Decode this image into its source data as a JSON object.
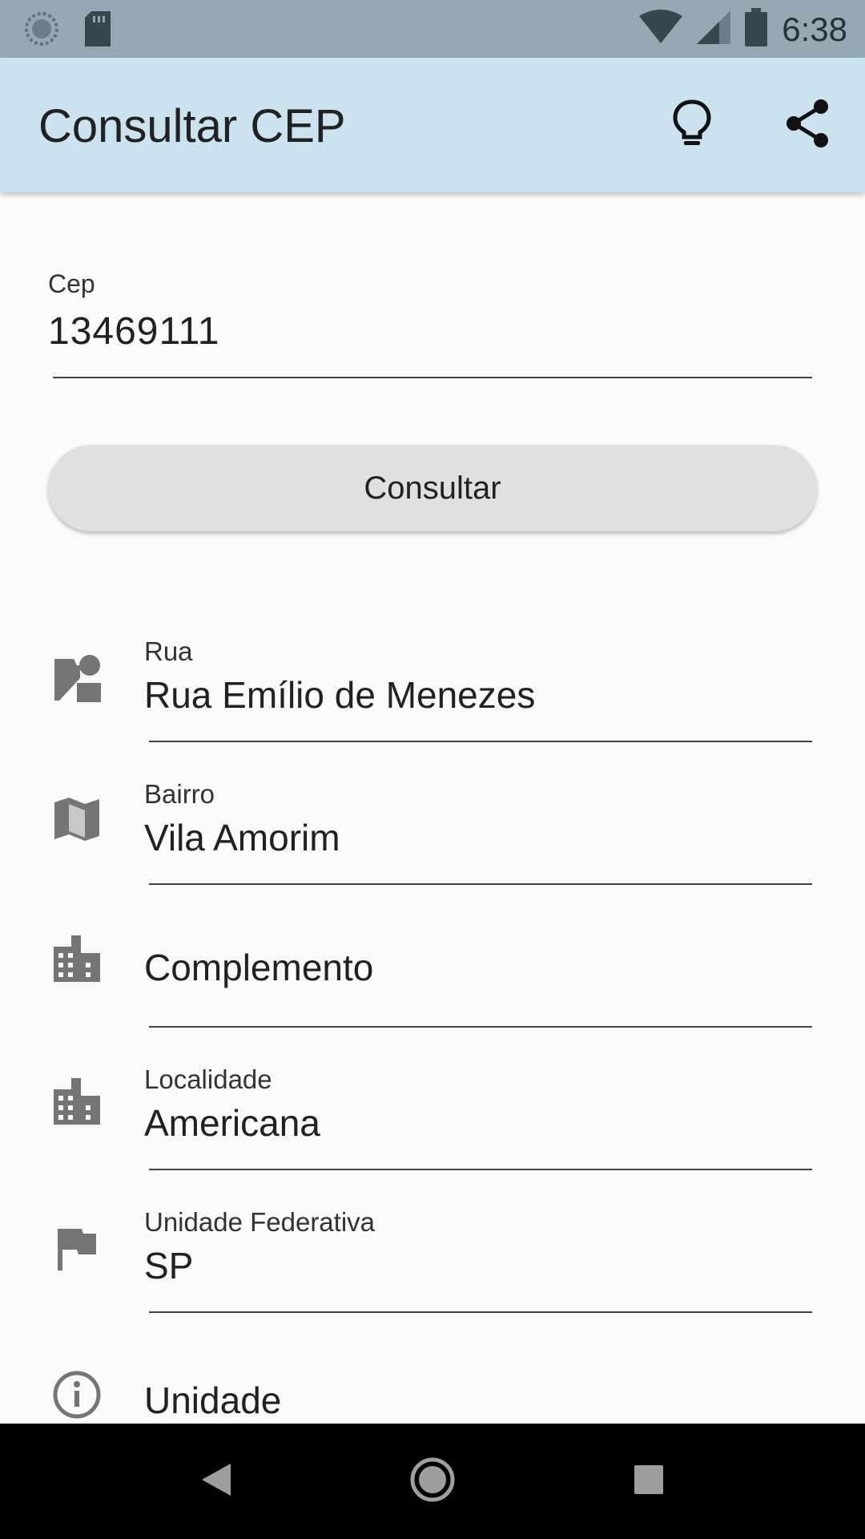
{
  "status_bar": {
    "time": "6:38",
    "icons": [
      "sync-icon",
      "sd-card-icon",
      "wifi-icon",
      "signal-icon",
      "battery-icon"
    ]
  },
  "app_bar": {
    "title": "Consultar CEP",
    "actions": [
      "lightbulb-icon",
      "share-icon"
    ]
  },
  "form": {
    "cep_label": "Cep",
    "cep_value": "13469111",
    "button_label": "Consultar"
  },
  "fields": [
    {
      "label": "Rua",
      "value": "Rua Emílio de Menezes",
      "icon": "street-icon"
    },
    {
      "label": "Bairro",
      "value": "Vila Amorim",
      "icon": "map-icon"
    },
    {
      "label": "",
      "value": "Complemento",
      "icon": "building-icon"
    },
    {
      "label": "Localidade",
      "value": "Americana",
      "icon": "city-icon"
    },
    {
      "label": "Unidade Federativa",
      "value": "SP",
      "icon": "flag-icon"
    },
    {
      "label": "",
      "value": "Unidade",
      "icon": "info-icon"
    }
  ],
  "nav_bar": {
    "buttons": [
      "back-icon",
      "home-icon",
      "recents-icon"
    ]
  },
  "colors": {
    "status_bar": "#96a9b3",
    "app_bar": "#cbe3ef",
    "background": "#fafafa",
    "button": "#e0e0e0",
    "icon_gray": "#757575"
  }
}
